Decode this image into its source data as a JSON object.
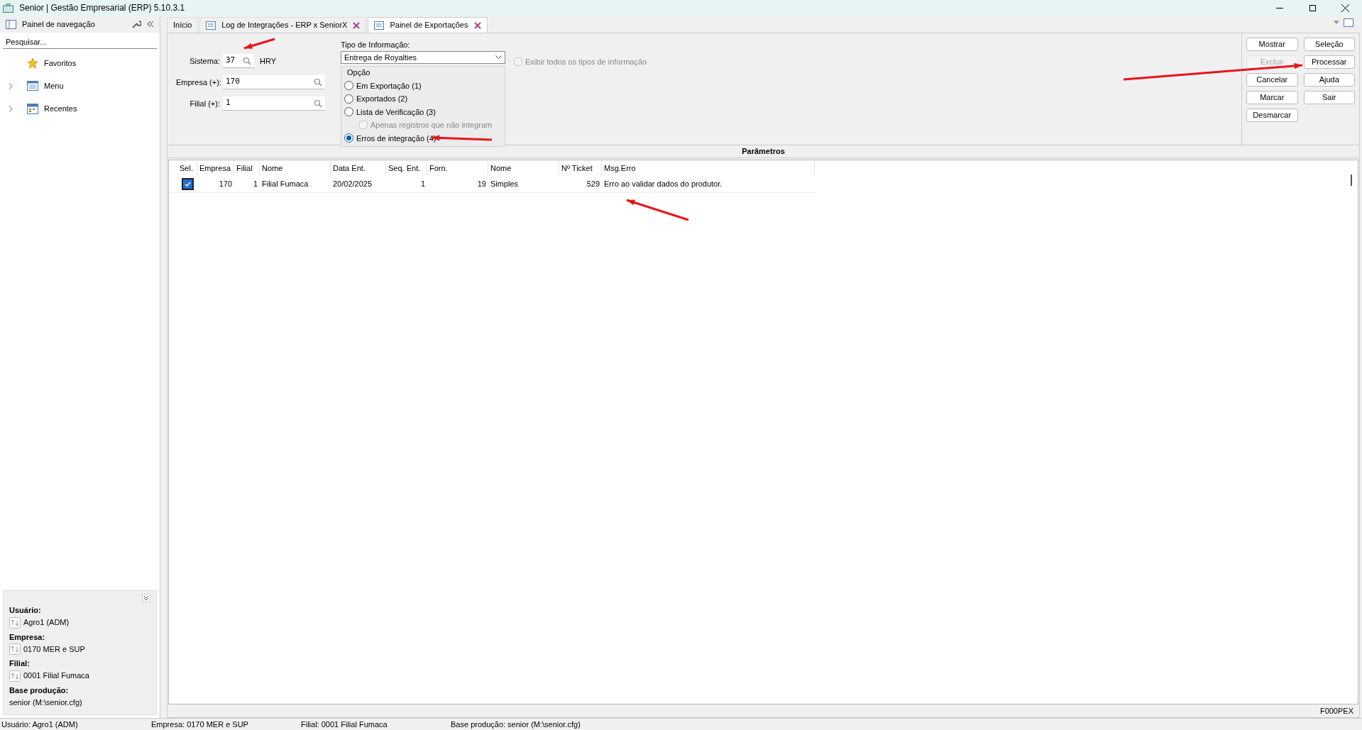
{
  "window": {
    "title": "Senior | Gestão Empresarial (ERP) 5.10.3.1"
  },
  "nav_panel": {
    "title": "Painel de navegação",
    "search": {
      "placeholder": "Pesquisar..."
    },
    "items": [
      {
        "label": "Favoritos",
        "expandable": false
      },
      {
        "label": "Menu",
        "expandable": true
      },
      {
        "label": "Recentes",
        "expandable": true
      }
    ],
    "session": [
      {
        "label": "Usuário:",
        "value": "Agro1 (ADM)",
        "kind": "switch"
      },
      {
        "label": "Empresa:",
        "value": "0170 MER e SUP",
        "kind": "switch"
      },
      {
        "label": "Filial:",
        "value": "0001 Filial Fumaca",
        "kind": "switch"
      },
      {
        "label": "Base produção:",
        "value": "senior (M:\\senior.cfg)",
        "kind": "text"
      }
    ]
  },
  "tabs": [
    {
      "label": "Início",
      "selected": false,
      "closable": false
    },
    {
      "label": "Log de Integrações - ERP x SeniorX",
      "selected": false,
      "closable": true
    },
    {
      "label": "Painel de Exportações",
      "selected": true,
      "closable": true
    }
  ],
  "form": {
    "sistema": {
      "label": "Sistema:",
      "value": "37",
      "suffix": "HRY"
    },
    "empresa": {
      "label": "Empresa (+):",
      "value": "170"
    },
    "filial": {
      "label": "Filial (+):",
      "value": "1"
    },
    "tipo": {
      "label": "Tipo de Informação:",
      "value": "Entrega de Royalties"
    },
    "exibir_todos": {
      "label": "Exibir todos os tipos de informação",
      "checked": false,
      "disabled": true
    },
    "opcao": {
      "title": "Opção",
      "options": [
        {
          "label": "Em Exportação (1)",
          "selected": false
        },
        {
          "label": "Exportados (2)",
          "selected": false
        },
        {
          "label": "Lista de Verificação (3)",
          "selected": false
        },
        {
          "label": "Erros de integração (4)",
          "selected": true
        }
      ],
      "sub_option": {
        "label": "Apenas registros que não integram",
        "checked": false,
        "disabled": true
      }
    }
  },
  "buttons": [
    {
      "label": "Mostrar",
      "disabled": false
    },
    {
      "label": "Seleção",
      "disabled": false
    },
    {
      "label": "Excluir",
      "disabled": true
    },
    {
      "label": "Processar",
      "disabled": false
    },
    {
      "label": "Cancelar",
      "disabled": false
    },
    {
      "label": "Ajuda",
      "disabled": false
    },
    {
      "label": "Marcar",
      "disabled": false
    },
    {
      "label": "Sair",
      "disabled": false
    },
    {
      "label": "Desmarcar",
      "disabled": false
    }
  ],
  "section_title": "Parâmetros",
  "table": {
    "columns": [
      "Sel.",
      "Empresa",
      "Filial",
      "Nome",
      "Data Ent.",
      "Seq. Ent.",
      "Forn.",
      "Nome",
      "Nº Ticket",
      "Msg.Erro"
    ],
    "rows": [
      {
        "checked": true,
        "cells": [
          "",
          "170",
          "1",
          "Filial Fumaca",
          "20/02/2025",
          "1",
          "19",
          "Simples",
          "529",
          "Erro ao validar dados do produtor."
        ]
      }
    ]
  },
  "screen_code": "F000PEX",
  "status_bar": [
    "Usuário: Agro1 (ADM)",
    "Empresa: 0170 MER e SUP",
    "Filial: 0001 Filial Fumaca",
    "Base produção: senior (M:\\senior.cfg)"
  ]
}
